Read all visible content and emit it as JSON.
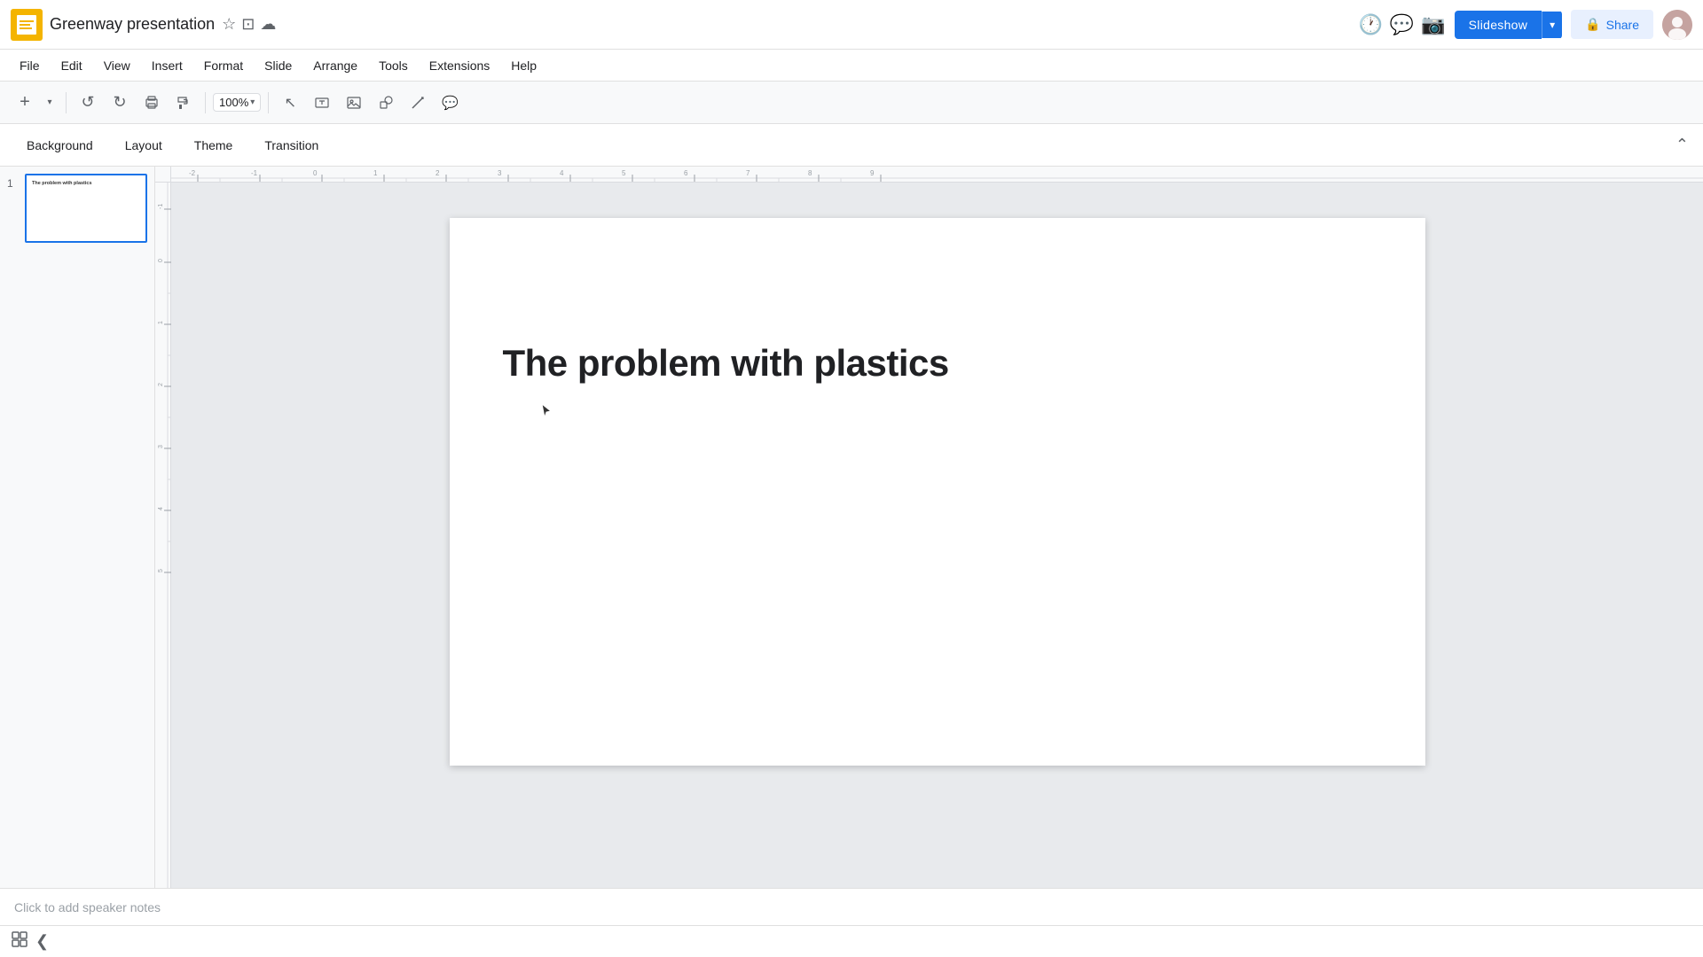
{
  "app": {
    "icon_color": "#0f9d58",
    "doc_title": "Greenway presentation",
    "star_icon": "★",
    "drive_icon": "⊡",
    "cloud_icon": "☁"
  },
  "top_right": {
    "history_icon": "🕐",
    "comments_icon": "💬",
    "camera_icon": "📷",
    "slideshow_label": "Slideshow",
    "slideshow_dropdown": "▾",
    "share_label": "Share"
  },
  "menu": {
    "items": [
      "File",
      "Edit",
      "View",
      "Insert",
      "Format",
      "Slide",
      "Arrange",
      "Tools",
      "Extensions",
      "Help"
    ]
  },
  "toolbar": {
    "add_slide_label": "+",
    "undo_label": "↺",
    "redo_label": "↻",
    "print_label": "🖨",
    "cursor_label": "↗",
    "zoom_label": "100%"
  },
  "slide_toolbar": {
    "items": [
      "Background",
      "Layout",
      "Theme",
      "Transition"
    ],
    "collapse_icon": "⌃"
  },
  "slides": [
    {
      "num": "1",
      "title": "The problem with plastics"
    }
  ],
  "slide": {
    "title": "The problem with plastics"
  },
  "ruler": {
    "h_ticks": [
      "-2",
      "-1",
      "0",
      "1",
      "2",
      "3",
      "4",
      "5",
      "6",
      "7",
      "8",
      "9"
    ],
    "v_ticks": [
      "-1",
      "0",
      "1",
      "2",
      "3",
      "4",
      "5"
    ]
  },
  "notes": {
    "placeholder": "Click to add speaker notes"
  },
  "bottom": {
    "grid_icon": "⊞",
    "panel_icon": "❮"
  }
}
